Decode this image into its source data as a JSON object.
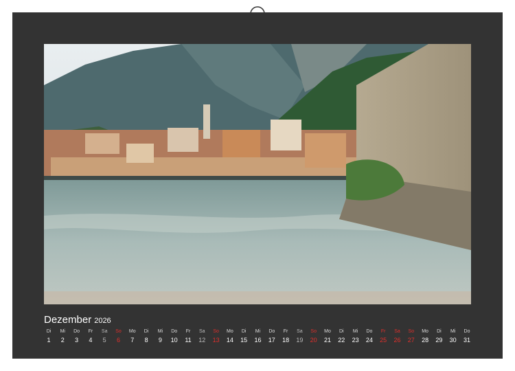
{
  "calendar": {
    "month": "Dezember",
    "year": "2026",
    "colors": {
      "sheet": "#333333",
      "text": "#ffffff",
      "holiday": "#e0302c",
      "saturday": "#bbbbbb"
    },
    "days": [
      {
        "dn": "Di",
        "dd": "1",
        "kind": "normal"
      },
      {
        "dn": "Mi",
        "dd": "2",
        "kind": "normal"
      },
      {
        "dn": "Do",
        "dd": "3",
        "kind": "normal"
      },
      {
        "dn": "Fr",
        "dd": "4",
        "kind": "normal"
      },
      {
        "dn": "Sa",
        "dd": "5",
        "kind": "sat"
      },
      {
        "dn": "So",
        "dd": "6",
        "kind": "red"
      },
      {
        "dn": "Mo",
        "dd": "7",
        "kind": "normal"
      },
      {
        "dn": "Di",
        "dd": "8",
        "kind": "normal"
      },
      {
        "dn": "Mi",
        "dd": "9",
        "kind": "normal"
      },
      {
        "dn": "Do",
        "dd": "10",
        "kind": "normal"
      },
      {
        "dn": "Fr",
        "dd": "11",
        "kind": "normal"
      },
      {
        "dn": "Sa",
        "dd": "12",
        "kind": "sat"
      },
      {
        "dn": "So",
        "dd": "13",
        "kind": "red"
      },
      {
        "dn": "Mo",
        "dd": "14",
        "kind": "normal"
      },
      {
        "dn": "Di",
        "dd": "15",
        "kind": "normal"
      },
      {
        "dn": "Mi",
        "dd": "16",
        "kind": "normal"
      },
      {
        "dn": "Do",
        "dd": "17",
        "kind": "normal"
      },
      {
        "dn": "Fr",
        "dd": "18",
        "kind": "normal"
      },
      {
        "dn": "Sa",
        "dd": "19",
        "kind": "sat"
      },
      {
        "dn": "So",
        "dd": "20",
        "kind": "red"
      },
      {
        "dn": "Mo",
        "dd": "21",
        "kind": "normal"
      },
      {
        "dn": "Di",
        "dd": "22",
        "kind": "normal"
      },
      {
        "dn": "Mi",
        "dd": "23",
        "kind": "normal"
      },
      {
        "dn": "Do",
        "dd": "24",
        "kind": "normal"
      },
      {
        "dn": "Fr",
        "dd": "25",
        "kind": "red"
      },
      {
        "dn": "Sa",
        "dd": "26",
        "kind": "red"
      },
      {
        "dn": "So",
        "dd": "27",
        "kind": "red"
      },
      {
        "dn": "Mo",
        "dd": "28",
        "kind": "normal"
      },
      {
        "dn": "Di",
        "dd": "29",
        "kind": "normal"
      },
      {
        "dn": "Mi",
        "dd": "30",
        "kind": "normal"
      },
      {
        "dn": "Do",
        "dd": "31",
        "kind": "normal"
      }
    ]
  },
  "photo": {
    "subject": "lakeside-village-photo"
  }
}
